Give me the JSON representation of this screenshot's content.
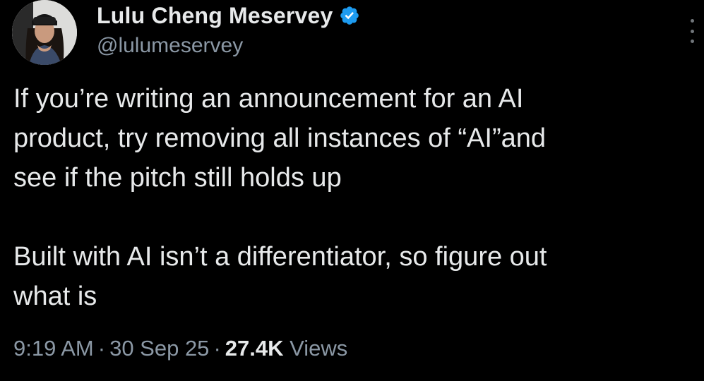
{
  "tweet": {
    "author": {
      "display_name": "Lulu Cheng Meservey",
      "handle": "@lulumeservey",
      "verified": true,
      "verified_icon": "verified-badge-icon",
      "avatar_icon": "avatar-photo"
    },
    "text": {
      "paragraph1": "If you’re writing an announcement for an AI\nproduct, try removing all instances of “AI”and\nsee if the pitch still holds up",
      "paragraph2": "Built with AI isn’t a differentiator, so figure out\nwhat is"
    },
    "meta": {
      "time": "9:19 AM",
      "separator": "·",
      "date": "30 Sep 25",
      "views_count": "27.4K",
      "views_label": "Views"
    },
    "more_menu_icon": "more-vertical-icon"
  },
  "colors": {
    "background": "#000000",
    "primary_text": "#e7e9ea",
    "secondary_text": "#8b98a5",
    "verified_blue": "#1d9bf0"
  }
}
